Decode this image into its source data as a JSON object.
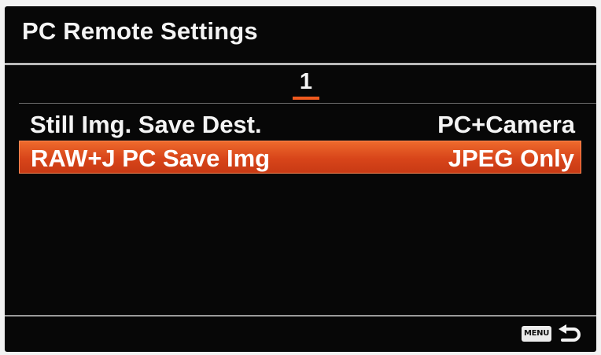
{
  "screen": {
    "title": "PC Remote Settings",
    "page_number": "1"
  },
  "menu": {
    "items": [
      {
        "label": "Still Img. Save Dest.",
        "value": "PC+Camera",
        "selected": false
      },
      {
        "label": "RAW+J PC Save Img",
        "value": "JPEG Only",
        "selected": true
      }
    ]
  },
  "footer": {
    "menu_button_label": "MENU",
    "back_icon": "return-arrow-icon"
  },
  "colors": {
    "background": "#070707",
    "selection": "#e0501e",
    "page_indicator": "#f05a1e",
    "text": "#f4f4f4"
  }
}
